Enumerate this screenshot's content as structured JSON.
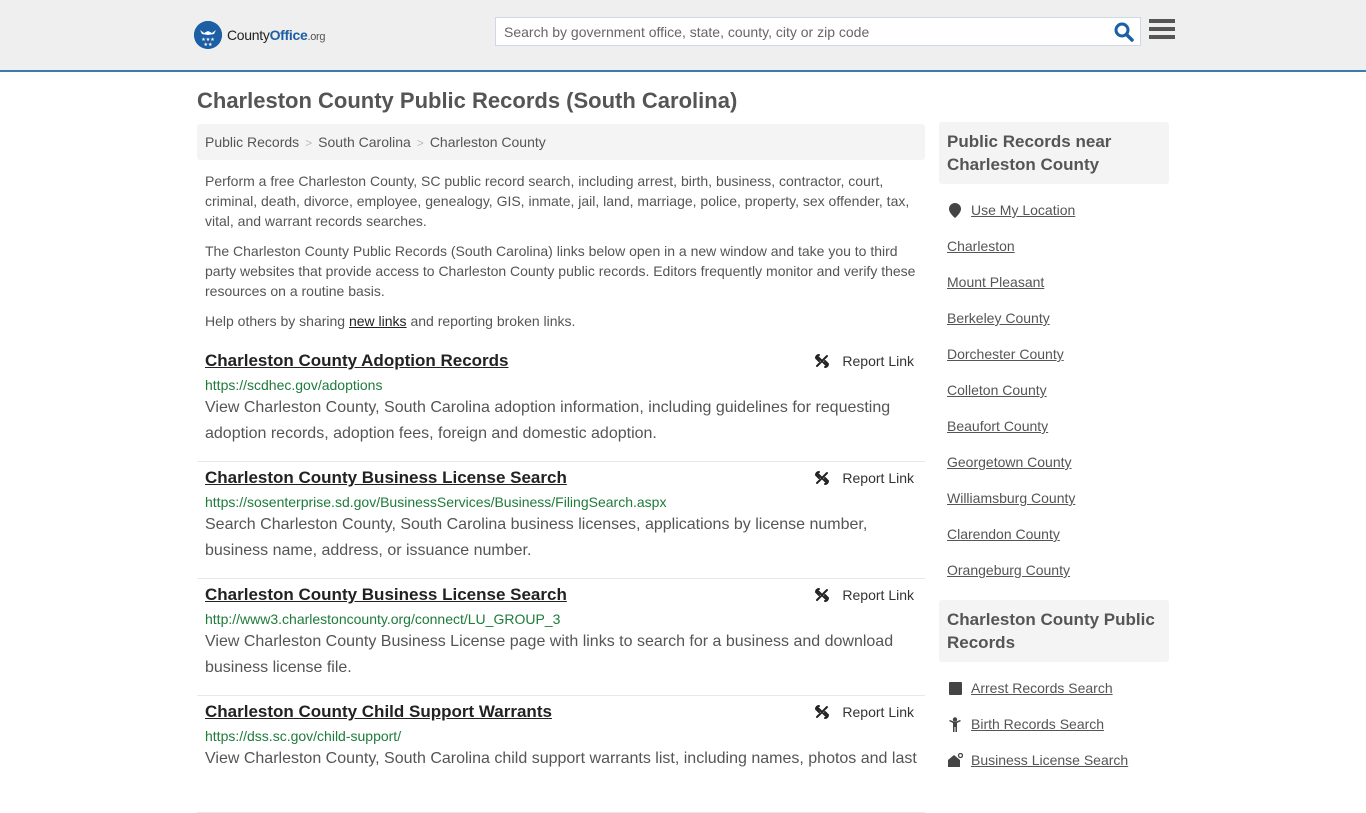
{
  "header": {
    "logo": {
      "prefix": "County",
      "brand": "Office",
      "suffix": ".org",
      "badge_icon": "eagle-stars"
    },
    "search": {
      "placeholder": "Search by government office, state, county, city or zip code",
      "value": ""
    },
    "search_icon": "magnifier",
    "menu_icon": "hamburger"
  },
  "page": {
    "title": "Charleston County Public Records (South Carolina)"
  },
  "breadcrumb": [
    {
      "label": "Public Records"
    },
    {
      "label": "South Carolina"
    },
    {
      "label": "Charleston County"
    }
  ],
  "breadcrumb_separator": ">",
  "intro": {
    "p1": "Perform a free Charleston County, SC public record search, including arrest, birth, business, contractor, court, criminal, death, divorce, employee, genealogy, GIS, inmate, jail, land, marriage, police, property, sex offender, tax, vital, and warrant records searches.",
    "p2": "The Charleston County Public Records (South Carolina) links below open in a new window and take you to third party websites that provide access to Charleston County public records. Editors frequently monitor and verify these resources on a routine basis.",
    "p3_before": "Help others by sharing ",
    "p3_link": "new links",
    "p3_after": " and reporting broken links."
  },
  "report_label": "Report Link",
  "records": [
    {
      "title": "Charleston County Adoption Records",
      "url": "https://scdhec.gov/adoptions",
      "description": "View Charleston County, South Carolina adoption information, including guidelines for requesting adoption records, adoption fees, foreign and domestic adoption."
    },
    {
      "title": "Charleston County Business License Search",
      "url": "https://sosenterprise.sd.gov/BusinessServices/Business/FilingSearch.aspx",
      "description": "Search Charleston County, South Carolina business licenses, applications by license number, business name, address, or issuance number."
    },
    {
      "title": "Charleston County Business License Search",
      "url": "http://www3.charlestoncounty.org/connect/LU_GROUP_3",
      "description": "View Charleston County Business License page with links to search for a business and download business license file."
    },
    {
      "title": "Charleston County Child Support Warrants",
      "url": "https://dss.sc.gov/child-support/",
      "description": "View Charleston County, South Carolina child support warrants list, including names, photos and last"
    }
  ],
  "sidebar": {
    "nearby": {
      "heading": "Public Records near Charleston County",
      "use_location": "Use My Location",
      "items": [
        "Charleston",
        "Mount Pleasant",
        "Berkeley County",
        "Dorchester County",
        "Colleton County",
        "Beaufort County",
        "Georgetown County",
        "Williamsburg County",
        "Clarendon County",
        "Orangeburg County"
      ]
    },
    "county_records": {
      "heading": "Charleston County Public Records",
      "items": [
        {
          "label": "Arrest Records Search",
          "icon": "square"
        },
        {
          "label": "Birth Records Search",
          "icon": "child"
        },
        {
          "label": "Business License Search",
          "icon": "business"
        }
      ]
    }
  },
  "colors": {
    "brand_blue": "#1c5fa5",
    "header_border": "#3a7bb0",
    "url_green": "#1e7b3a",
    "text_gray": "#555555",
    "panel_bg": "#f4f4f4"
  }
}
